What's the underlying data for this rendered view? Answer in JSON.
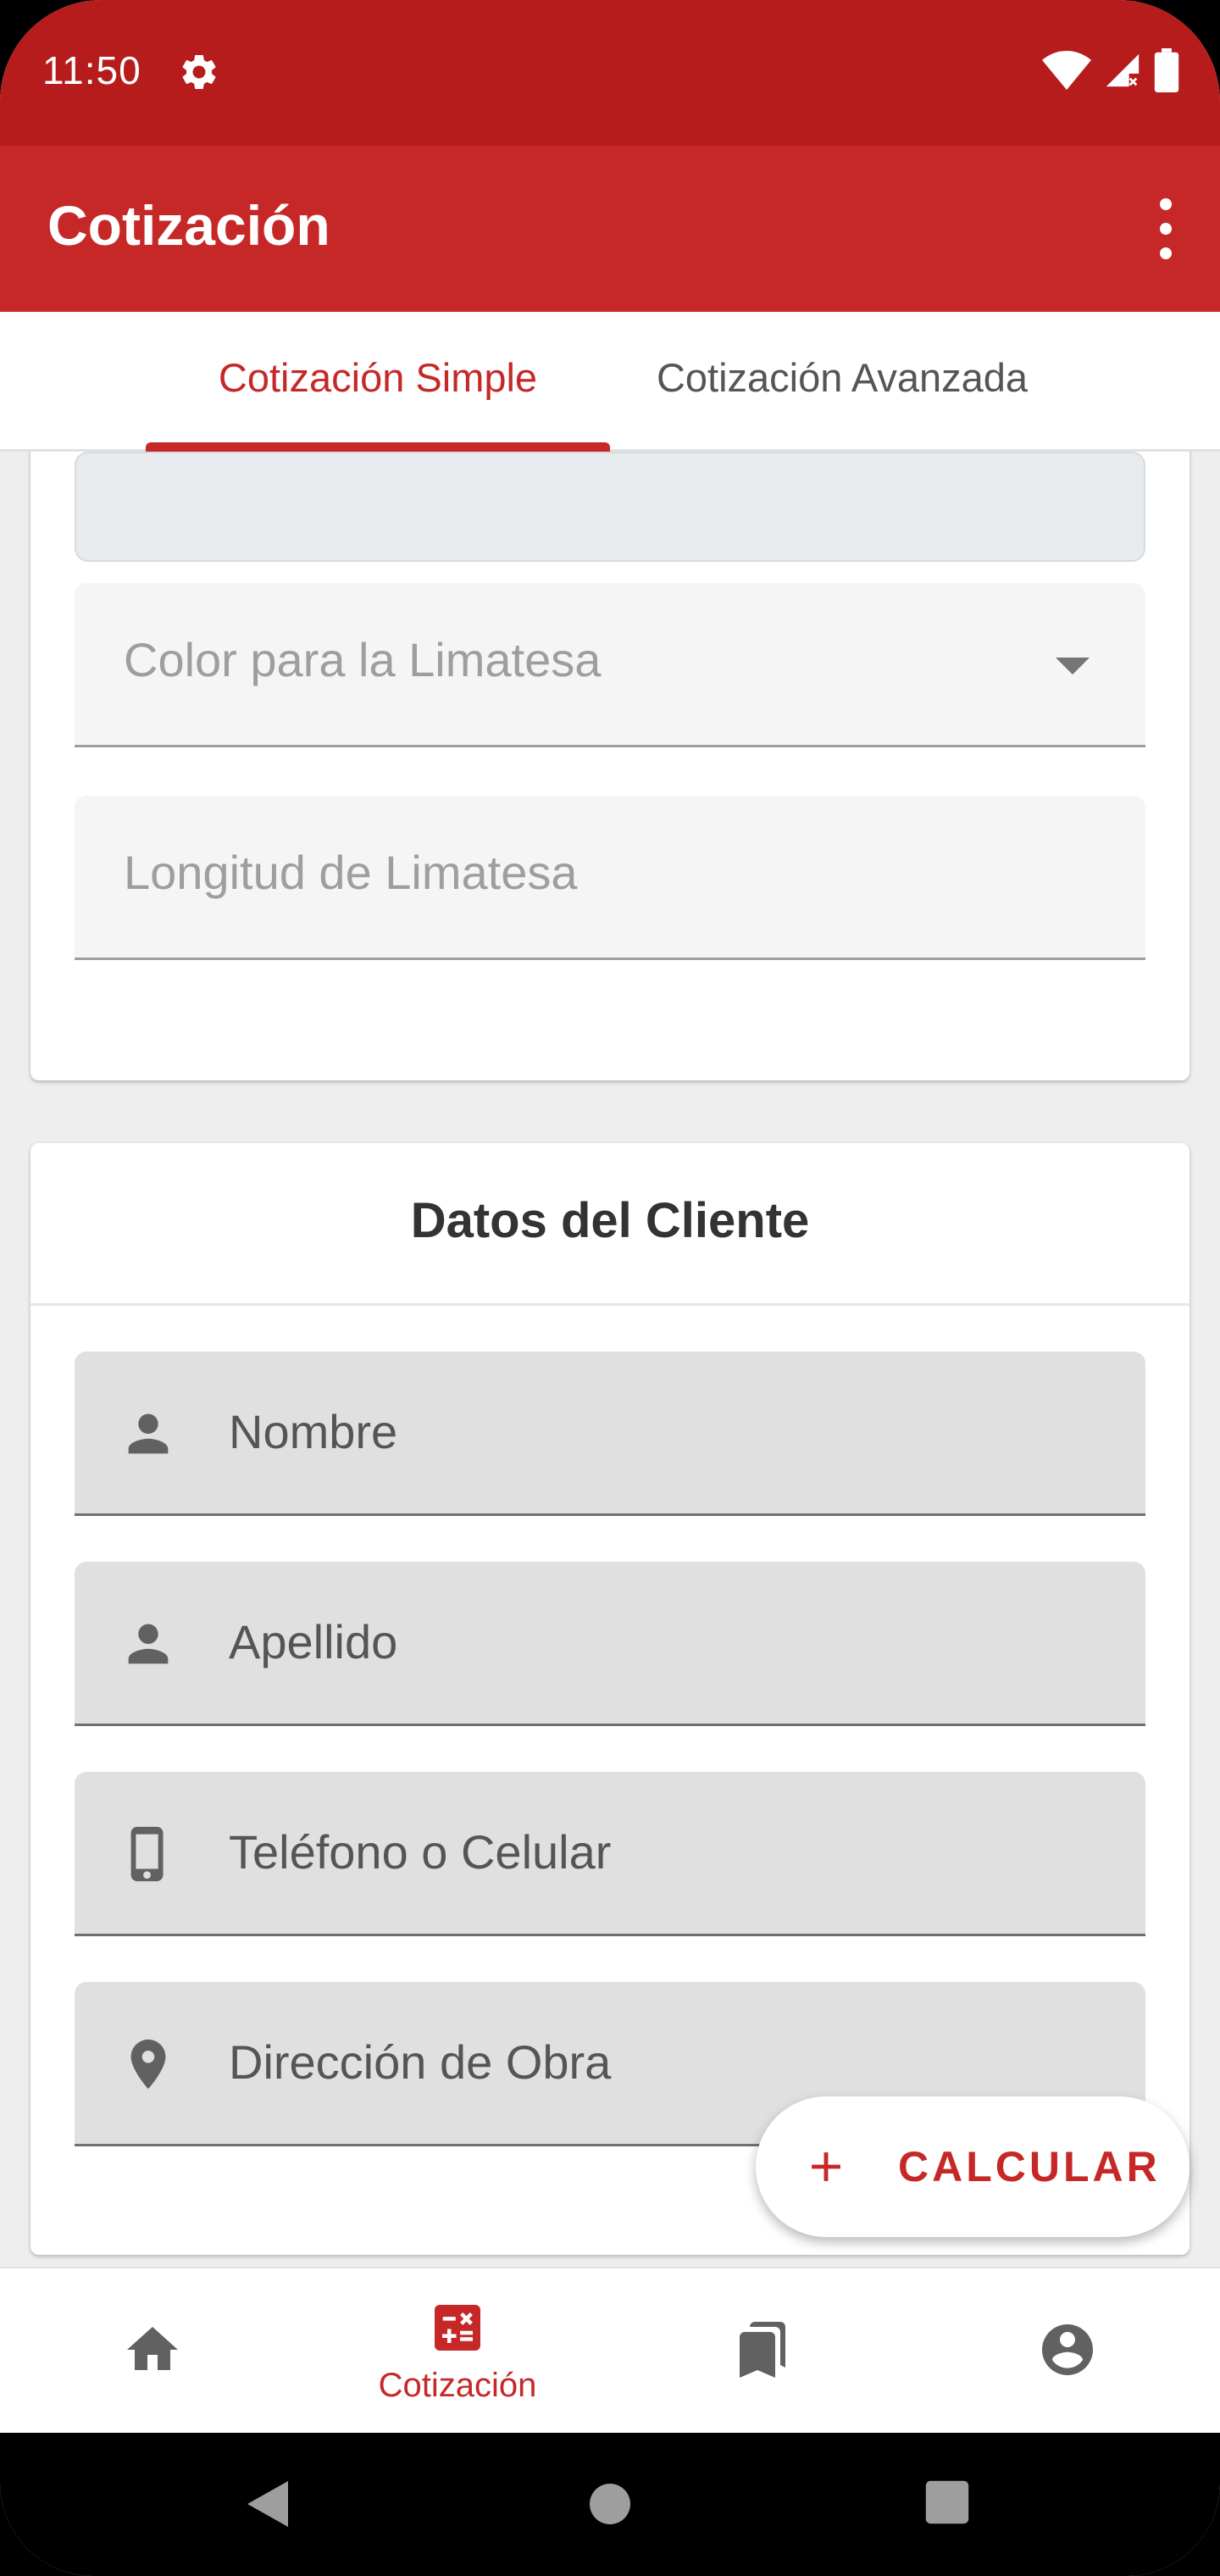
{
  "status_bar": {
    "time": "11:50"
  },
  "app_bar": {
    "title": "Cotización"
  },
  "tabs": [
    {
      "label": "Cotización Simple",
      "active": true
    },
    {
      "label": "Cotización Avanzada",
      "active": false
    }
  ],
  "material_card": {
    "fields": [
      {
        "label": "Color para la Limatesa",
        "type": "dropdown"
      },
      {
        "label": "Longitud de Limatesa",
        "type": "text"
      }
    ]
  },
  "client_card": {
    "title": "Datos del Cliente",
    "fields": [
      {
        "label": "Nombre",
        "icon": "person-icon"
      },
      {
        "label": "Apellido",
        "icon": "person-icon"
      },
      {
        "label": "Teléfono o Celular",
        "icon": "phone-icon"
      },
      {
        "label": "Dirección de Obra",
        "icon": "location-pin-icon"
      }
    ]
  },
  "fab": {
    "label": "CALCULAR",
    "icon": "plus-icon"
  },
  "bottom_nav": {
    "items": [
      {
        "icon": "home-icon",
        "label": ""
      },
      {
        "icon": "calculator-icon",
        "label": "Cotización",
        "active": true
      },
      {
        "icon": "bookmarks-icon",
        "label": ""
      },
      {
        "icon": "account-icon",
        "label": ""
      }
    ]
  },
  "colors": {
    "primary": "#c62828",
    "primary_dark": "#b71c1c",
    "background": "#eeeeee"
  }
}
